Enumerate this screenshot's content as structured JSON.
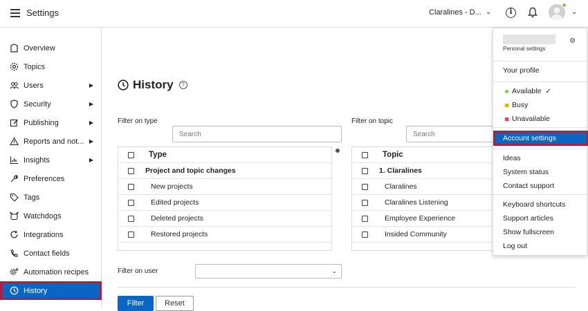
{
  "header": {
    "title": "Settings",
    "project_name": "Claralines - D...",
    "colors": {
      "accent": "#0a66c2",
      "highlight_border": "#b01e3a",
      "status_online": "#8dc63f"
    }
  },
  "sidebar": {
    "items": [
      {
        "label": "Overview",
        "icon": "overview-icon",
        "has_arrow": false
      },
      {
        "label": "Topics",
        "icon": "gear-icon",
        "has_arrow": false
      },
      {
        "label": "Users",
        "icon": "users-icon",
        "has_arrow": true
      },
      {
        "label": "Security",
        "icon": "shield-icon",
        "has_arrow": true
      },
      {
        "label": "Publishing",
        "icon": "edit-icon",
        "has_arrow": true
      },
      {
        "label": "Reports and not...",
        "icon": "warning-icon",
        "has_arrow": true
      },
      {
        "label": "Insights",
        "icon": "chart-icon",
        "has_arrow": true
      },
      {
        "label": "Preferences",
        "icon": "wrench-icon",
        "has_arrow": false
      },
      {
        "label": "Tags",
        "icon": "tag-icon",
        "has_arrow": false
      },
      {
        "label": "Watchdogs",
        "icon": "watchdog-icon",
        "has_arrow": false
      },
      {
        "label": "Integrations",
        "icon": "refresh-icon",
        "has_arrow": false
      },
      {
        "label": "Contact fields",
        "icon": "contact-icon",
        "has_arrow": false
      },
      {
        "label": "Automation recipes",
        "icon": "automation-icon",
        "has_arrow": false
      },
      {
        "label": "History",
        "icon": "clock-icon",
        "has_arrow": false,
        "active": true
      }
    ]
  },
  "main": {
    "title": "History",
    "filter_type_label": "Filter on type",
    "filter_topic_label": "Filter on topic",
    "filter_user_label": "Filter on user",
    "search_placeholder": "Search",
    "type_table": {
      "header": "Type",
      "rows": [
        {
          "label": "Project and topic changes",
          "bold": true
        },
        {
          "label": "New projects",
          "bold": false
        },
        {
          "label": "Edited projects",
          "bold": false
        },
        {
          "label": "Deleted projects",
          "bold": false
        },
        {
          "label": "Restored projects",
          "bold": false
        }
      ]
    },
    "topic_table": {
      "header": "Topic",
      "rows": [
        {
          "label": "1. Claralines",
          "bold": true
        },
        {
          "label": "Claralines",
          "bold": false
        },
        {
          "label": "Claralines Listening",
          "bold": false
        },
        {
          "label": "Employee Experience",
          "bold": false
        },
        {
          "label": "Insided Community",
          "bold": false
        }
      ]
    },
    "filter_button": "Filter",
    "reset_button": "Reset"
  },
  "dropdown": {
    "personal_settings": "Personal settings",
    "your_profile": "Your profile",
    "statuses": [
      {
        "label": "Available",
        "color": "#8dc63f",
        "checked": true
      },
      {
        "label": "Busy",
        "color": "#f5a623",
        "checked": false
      },
      {
        "label": "Unavailable",
        "color": "#e8434f",
        "checked": false
      }
    ],
    "account_settings": "Account settings",
    "group2": [
      "Ideas",
      "System status",
      "Contact support"
    ],
    "group3": [
      "Keyboard shortcuts",
      "Support articles",
      "Show fullscreen",
      "Log out"
    ]
  }
}
